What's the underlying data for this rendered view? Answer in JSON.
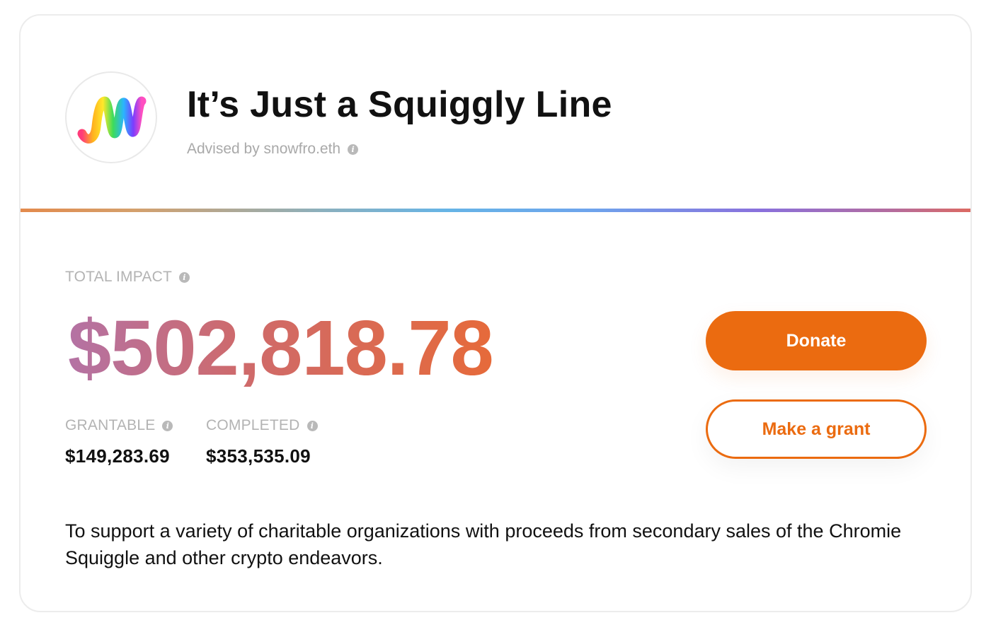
{
  "header": {
    "title": "It’s Just a Squiggly Line",
    "advised_by": "Advised by snowfro.eth",
    "logo_icon": "squiggle-logo-icon"
  },
  "impact": {
    "label": "TOTAL IMPACT",
    "amount": "$502,818.78",
    "grantable_label": "GRANTABLE",
    "grantable_value": "$149,283.69",
    "completed_label": "COMPLETED",
    "completed_value": "$353,535.09"
  },
  "actions": {
    "donate_label": "Donate",
    "grant_label": "Make a grant"
  },
  "description": "To support a variety of charitable organizations with proceeds from secondary sales of the Chromie Squiggle and other crypto endeavors.",
  "info_icon_glyph": "i",
  "colors": {
    "accent": "#eb6b10",
    "amount_gradient_start": "#b472a4",
    "amount_gradient_end": "#e66a3a",
    "muted_text": "#b3b3b3"
  }
}
